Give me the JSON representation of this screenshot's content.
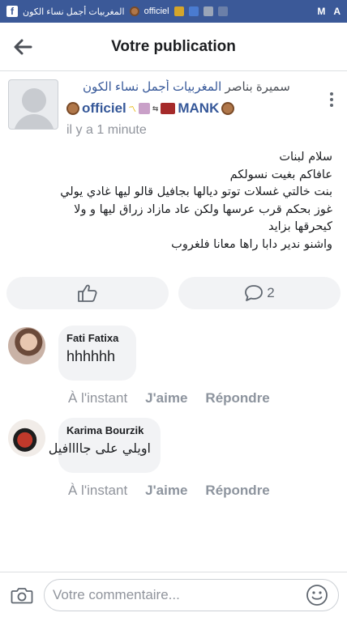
{
  "status_bar": {
    "fb_letter": "f",
    "group_text": "المغربيات أجمل نساء الكون",
    "page_text": "officiel",
    "right_letters": [
      "M",
      "A"
    ]
  },
  "header": {
    "title": "Votre publication"
  },
  "post": {
    "author_name": "سميرة بناصر",
    "group_name": "المغربيات أجمل نساء الكون",
    "page_name": "officiel",
    "page_suffix": "MANK",
    "time": "il y a 1 minute",
    "lines": [
      "سلام لبنات",
      "عافاكم بغيت نسولكم",
      "بنت خالتي غسلات توتو ديالها بجافيل قالو ليها غادي يولي",
      "غوز بحكم قرب عرسها ولكن عاد مازاد زراق ليها و ولا",
      "كيحرقها بزايد",
      "واشنو ندير دابا راها معانا فلغروب"
    ],
    "comment_count": "2"
  },
  "comments": [
    {
      "name": "Fati Fatixa",
      "text": "hhhhhh",
      "time": "À l'instant",
      "like_label": "J'aime",
      "reply_label": "Répondre"
    },
    {
      "name": "Karima Bourzik",
      "text": "اويلي على جاااافيل",
      "time": "À l'instant",
      "like_label": "J'aime",
      "reply_label": "Répondre"
    }
  ],
  "composer": {
    "placeholder": "Votre commentaire..."
  },
  "icons": {
    "back": "arrow-left-icon",
    "more": "vertical-dots-icon",
    "like": "thumbs-up-icon",
    "comment": "speech-bubble-icon",
    "camera": "camera-icon",
    "emoji": "smiley-icon"
  },
  "colors": {
    "status_bar": "#3b5998",
    "link": "#365899",
    "muted": "#90949c",
    "pill": "#f2f3f5"
  }
}
